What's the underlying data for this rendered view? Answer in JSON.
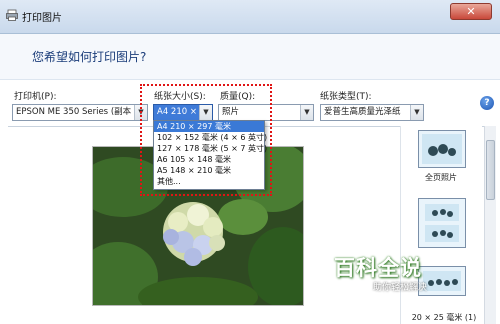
{
  "window": {
    "title": "打印图片",
    "close_glyph": "✕"
  },
  "header": {
    "question": "您希望如何打印图片?"
  },
  "printer": {
    "label": "打印机(P):",
    "value": "EPSON ME 350 Series (副本 1)"
  },
  "paper_size": {
    "label": "纸张大小(S):",
    "value": "A4 210 × 29",
    "options": [
      "A4 210 × 297 毫米",
      "102 × 152 毫米 (4 × 6 英寸)",
      "127 × 178 毫米 (5 × 7 英寸)",
      "A6 105 × 148 毫米",
      "A5 148 × 210 毫米",
      "其他..."
    ],
    "active_index": 0
  },
  "quality": {
    "label": "质量(Q):",
    "value": "照片"
  },
  "paper_type": {
    "label": "纸张类型(T):",
    "value": "爱普生高质量光泽纸"
  },
  "help": {
    "glyph": "?"
  },
  "layouts": [
    {
      "label": "全页照片"
    },
    {
      "label": ""
    }
  ],
  "layout_bottom_label": "20 × 25 毫米 (1)",
  "watermark": {
    "main": "百科全说",
    "sub": "助你轻松解决"
  },
  "colors": {
    "accent": "#3a79d6",
    "highlight_box": "#e01414",
    "header_text": "#1b3d7a"
  }
}
